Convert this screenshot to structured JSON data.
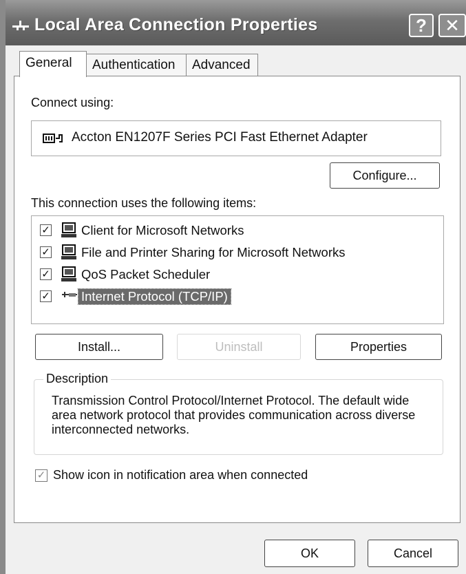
{
  "window": {
    "title": "Local Area Connection  Properties",
    "help_label": "?",
    "close_label": "✕"
  },
  "tabs": [
    {
      "label": "General",
      "active": true
    },
    {
      "label": "Authentication",
      "active": false
    },
    {
      "label": "Advanced",
      "active": false
    }
  ],
  "general": {
    "connect_using_label": "Connect using:",
    "adapter_name": "Accton EN1207F Series PCI Fast Ethernet Adapter",
    "configure_label": "Configure...",
    "items_label": "This connection uses the following items:",
    "items": [
      {
        "label": "Client for Microsoft Networks",
        "checked": true,
        "icon": "network-client-icon"
      },
      {
        "label": "File and Printer Sharing for Microsoft Networks",
        "checked": true,
        "icon": "file-printer-sharing-icon"
      },
      {
        "label": "QoS Packet Scheduler",
        "checked": true,
        "icon": "qos-scheduler-icon"
      },
      {
        "label": "Internet Protocol (TCP/IP)",
        "checked": true,
        "selected": true,
        "icon": "protocol-icon"
      }
    ],
    "install_label": "Install...",
    "uninstall_label": "Uninstall",
    "properties_label": "Properties",
    "description_legend": "Description",
    "description_text": "Transmission Control Protocol/Internet Protocol. The default wide area network protocol that provides communication across diverse interconnected networks.",
    "notify_label": "Show icon in notification area when connected",
    "notify_checked": true
  },
  "footer": {
    "ok_label": "OK",
    "cancel_label": "Cancel"
  }
}
